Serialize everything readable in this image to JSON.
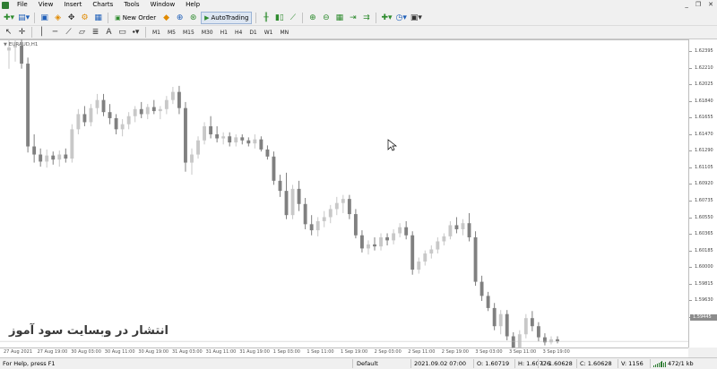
{
  "menu": [
    "File",
    "View",
    "Insert",
    "Charts",
    "Tools",
    "Window",
    "Help"
  ],
  "toolbar": {
    "new_order_label": "New Order",
    "autotrading_label": "AutoTrading"
  },
  "timeframes": [
    "M1",
    "M5",
    "M15",
    "M30",
    "H1",
    "H4",
    "D1",
    "W1",
    "MN"
  ],
  "chart": {
    "symbol_title": "EURAUD,H1"
  },
  "price_axis": {
    "labels": [
      "1.62395",
      "1.62210",
      "1.62025",
      "1.61840",
      "1.61655",
      "1.61470",
      "1.61290",
      "1.61105",
      "1.60920",
      "1.60735",
      "1.60550",
      "1.60365",
      "1.60185",
      "1.60000",
      "1.59815",
      "1.59630",
      "1.59445"
    ],
    "current_price": "1.59445"
  },
  "time_axis": {
    "labels": [
      "27 Aug 2021",
      "27 Aug 19:00",
      "30 Aug 03:00",
      "30 Aug 11:00",
      "30 Aug 19:00",
      "31 Aug 03:00",
      "31 Aug 11:00",
      "31 Aug 19:00",
      "1 Sep 03:00",
      "1 Sep 11:00",
      "1 Sep 19:00",
      "2 Sep 03:00",
      "2 Sep 11:00",
      "2 Sep 19:00",
      "3 Sep 03:00",
      "3 Sep 11:00",
      "3 Sep 19:00"
    ]
  },
  "watermark": "انتشار در وبسایت سود آموز",
  "status": {
    "help": "For Help, press F1",
    "profile": "Default",
    "datetime": "2021.09.02 07:00",
    "open": "O: 1.60719",
    "high": "H: 1.60776",
    "low": "L: 1.60628",
    "close": "C: 1.60628",
    "volume": "V: 1156",
    "traffic": "472/1 kb"
  },
  "chart_data": {
    "type": "candlestick",
    "title": "EURAUD,H1",
    "xlabel": "",
    "ylabel": "",
    "ylim": [
      1.59389,
      1.6244
    ],
    "grid": false,
    "x_labels": [
      "27 Aug 2021",
      "27 Aug 19:00",
      "30 Aug 03:00",
      "30 Aug 11:00",
      "30 Aug 19:00",
      "31 Aug 03:00",
      "31 Aug 11:00",
      "31 Aug 19:00",
      "1 Sep 03:00",
      "1 Sep 11:00",
      "1 Sep 19:00",
      "2 Sep 03:00",
      "2 Sep 11:00",
      "2 Sep 19:00",
      "3 Sep 03:00",
      "3 Sep 11:00",
      "3 Sep 19:00"
    ],
    "bull_color": "#c8c8c8",
    "bear_color": "#808080",
    "candles": [
      [
        1.6233,
        1.625,
        1.6215,
        1.6236
      ],
      [
        1.6236,
        1.6248,
        1.6222,
        1.6238
      ],
      [
        1.6238,
        1.6244,
        1.6215,
        1.622
      ],
      [
        1.622,
        1.6226,
        1.6132,
        1.6138
      ],
      [
        1.6138,
        1.615,
        1.6122,
        1.613
      ],
      [
        1.613,
        1.6136,
        1.6118,
        1.6123
      ],
      [
        1.6123,
        1.6135,
        1.6117,
        1.6129
      ],
      [
        1.6129,
        1.6133,
        1.612,
        1.6125
      ],
      [
        1.6125,
        1.6134,
        1.6118,
        1.613
      ],
      [
        1.613,
        1.6136,
        1.6122,
        1.6126
      ],
      [
        1.6126,
        1.616,
        1.6122,
        1.6155
      ],
      [
        1.6155,
        1.6175,
        1.615,
        1.617
      ],
      [
        1.617,
        1.6178,
        1.6158,
        1.6162
      ],
      [
        1.6162,
        1.618,
        1.6158,
        1.6176
      ],
      [
        1.6176,
        1.619,
        1.617,
        1.6184
      ],
      [
        1.6184,
        1.619,
        1.6168,
        1.6172
      ],
      [
        1.6172,
        1.618,
        1.616,
        1.6166
      ],
      [
        1.6166,
        1.617,
        1.615,
        1.6155
      ],
      [
        1.6155,
        1.6165,
        1.6148,
        1.616
      ],
      [
        1.616,
        1.6172,
        1.6155,
        1.6168
      ],
      [
        1.6168,
        1.6178,
        1.6162,
        1.6175
      ],
      [
        1.6175,
        1.6182,
        1.6166,
        1.617
      ],
      [
        1.617,
        1.618,
        1.6165,
        1.6177
      ],
      [
        1.6177,
        1.6184,
        1.617,
        1.6173
      ],
      [
        1.6173,
        1.6178,
        1.6165,
        1.6175
      ],
      [
        1.6175,
        1.6188,
        1.617,
        1.6184
      ],
      [
        1.6184,
        1.6197,
        1.618,
        1.6192
      ],
      [
        1.6192,
        1.6198,
        1.617,
        1.6176
      ],
      [
        1.6176,
        1.6182,
        1.6113,
        1.6122
      ],
      [
        1.6122,
        1.6136,
        1.611,
        1.613
      ],
      [
        1.613,
        1.6148,
        1.6126,
        1.6144
      ],
      [
        1.6144,
        1.6162,
        1.614,
        1.6158
      ],
      [
        1.6158,
        1.6168,
        1.6146,
        1.615
      ],
      [
        1.615,
        1.6158,
        1.6142,
        1.6146
      ],
      [
        1.6146,
        1.6152,
        1.614,
        1.6148
      ],
      [
        1.6148,
        1.6152,
        1.6138,
        1.6142
      ],
      [
        1.6142,
        1.615,
        1.6138,
        1.6147
      ],
      [
        1.6147,
        1.615,
        1.614,
        1.6144
      ],
      [
        1.6144,
        1.6147,
        1.6138,
        1.6141
      ],
      [
        1.6141,
        1.615,
        1.6136,
        1.6145
      ],
      [
        1.6145,
        1.6148,
        1.6133,
        1.6135
      ],
      [
        1.6135,
        1.6139,
        1.6125,
        1.6128
      ],
      [
        1.6128,
        1.6133,
        1.61,
        1.6104
      ],
      [
        1.6104,
        1.611,
        1.6088,
        1.6094
      ],
      [
        1.6094,
        1.6112,
        1.6066,
        1.607
      ],
      [
        1.607,
        1.61,
        1.6066,
        1.6096
      ],
      [
        1.6096,
        1.6104,
        1.6074,
        1.6081
      ],
      [
        1.6081,
        1.6087,
        1.6056,
        1.6061
      ],
      [
        1.6061,
        1.607,
        1.605,
        1.6055
      ],
      [
        1.6055,
        1.6068,
        1.6049,
        1.6064
      ],
      [
        1.6064,
        1.6074,
        1.6058,
        1.6068
      ],
      [
        1.6068,
        1.608,
        1.6062,
        1.6076
      ],
      [
        1.6076,
        1.6088,
        1.607,
        1.6082
      ],
      [
        1.6082,
        1.609,
        1.6072,
        1.6086
      ],
      [
        1.6086,
        1.609,
        1.6066,
        1.6071
      ],
      [
        1.6071,
        1.6076,
        1.6047,
        1.605
      ],
      [
        1.605,
        1.6055,
        1.6033,
        1.6037
      ],
      [
        1.6037,
        1.6045,
        1.6031,
        1.6041
      ],
      [
        1.6041,
        1.6048,
        1.6035,
        1.6039
      ],
      [
        1.6039,
        1.6052,
        1.6035,
        1.6048
      ],
      [
        1.6048,
        1.6052,
        1.604,
        1.6045
      ],
      [
        1.6045,
        1.6056,
        1.6041,
        1.6052
      ],
      [
        1.6052,
        1.6062,
        1.6048,
        1.6058
      ],
      [
        1.6058,
        1.6064,
        1.6046,
        1.605
      ],
      [
        1.605,
        1.6054,
        1.6011,
        1.6016
      ],
      [
        1.6016,
        1.6028,
        1.6012,
        1.6024
      ],
      [
        1.6024,
        1.6035,
        1.602,
        1.6032
      ],
      [
        1.6032,
        1.604,
        1.6027,
        1.6036
      ],
      [
        1.6036,
        1.6048,
        1.6032,
        1.6044
      ],
      [
        1.6044,
        1.6052,
        1.604,
        1.6049
      ],
      [
        1.6049,
        1.6064,
        1.6046,
        1.606
      ],
      [
        1.606,
        1.6068,
        1.6052,
        1.6056
      ],
      [
        1.6056,
        1.6066,
        1.605,
        1.6062
      ],
      [
        1.6062,
        1.6072,
        1.6044,
        1.6048
      ],
      [
        1.6048,
        1.6054,
        1.6,
        1.6004
      ],
      [
        1.6004,
        1.601,
        1.5985,
        1.599
      ],
      [
        1.599,
        1.5994,
        1.5975,
        1.5978
      ],
      [
        1.5978,
        1.5983,
        1.5956,
        1.596
      ],
      [
        1.596,
        1.5976,
        1.5952,
        1.5972
      ],
      [
        1.5972,
        1.5976,
        1.5946,
        1.595
      ],
      [
        1.595,
        1.5954,
        1.5929,
        1.5935
      ],
      [
        1.5935,
        1.5956,
        1.593,
        1.5952
      ],
      [
        1.5952,
        1.5972,
        1.5948,
        1.5968
      ],
      [
        1.5968,
        1.5975,
        1.5955,
        1.596
      ],
      [
        1.596,
        1.5964,
        1.5945,
        1.5949
      ],
      [
        1.5949,
        1.5953,
        1.5941,
        1.5944
      ],
      [
        1.5944,
        1.595,
        1.5942,
        1.5947
      ],
      [
        1.5947,
        1.595,
        1.5943,
        1.5945
      ]
    ]
  }
}
